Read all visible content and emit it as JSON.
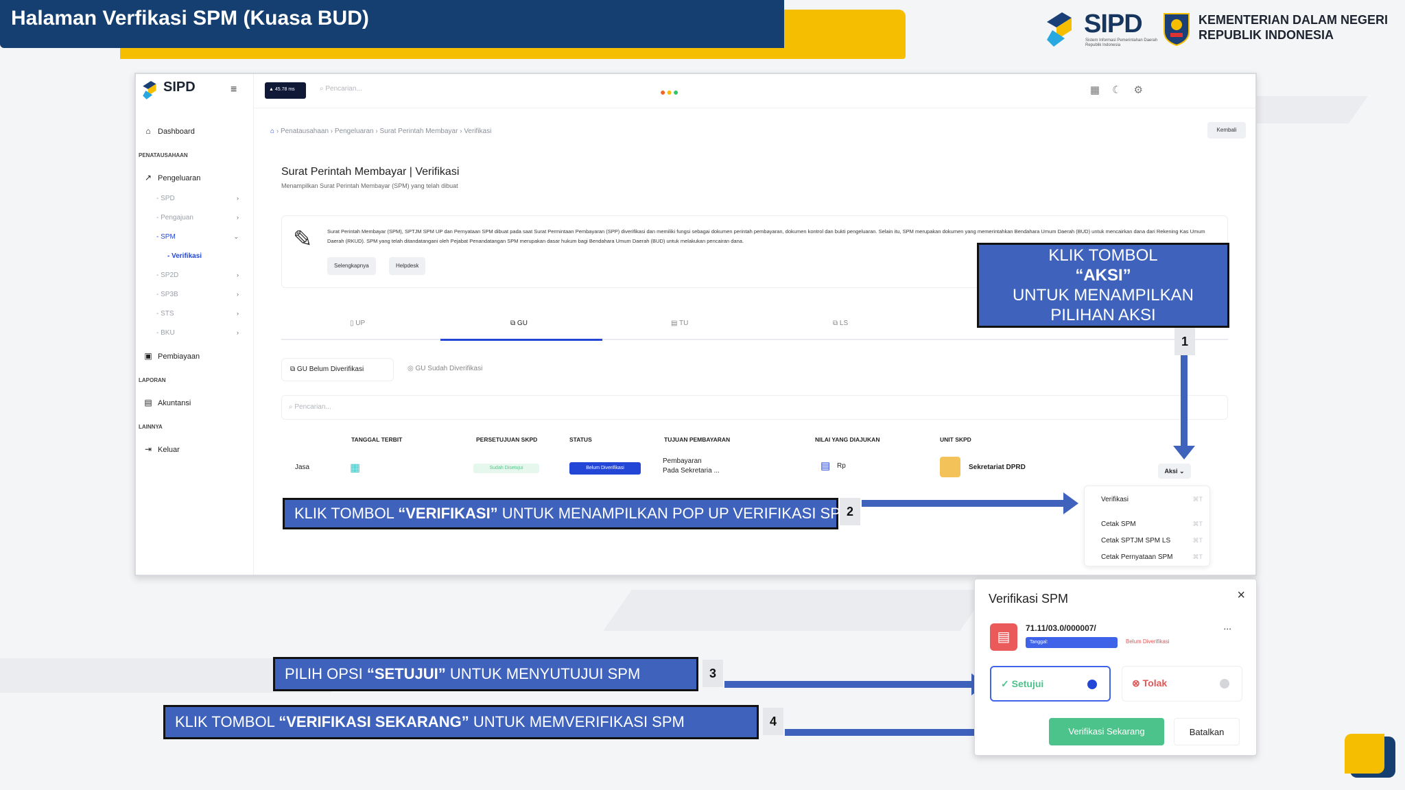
{
  "banner": {
    "title": "Halaman Verfikasi SPM (Kuasa BUD)"
  },
  "brand": {
    "sipd_word": "SIPD",
    "sipd_sub": "Sistem Informasi Pemerintahan Daerah Republik Indonesia",
    "ministry_line1": "KEMENTERIAN DALAM NEGERI",
    "ministry_line2": "REPUBLIK INDONESIA"
  },
  "app": {
    "logo": "SIPD",
    "topbar": {
      "chip": "▲ 45.78 ms",
      "search_placeholder": "Pencarian...",
      "back": "Kembali"
    },
    "sidebar": {
      "dashboard": "Dashboard",
      "section_penatausahaan": "PENATAUSAHAAN",
      "pengeluaran": "Pengeluaran",
      "sub": [
        "SPD",
        "Pengajuan",
        "SPM",
        "Verifikasi",
        "SP2D",
        "SP3B",
        "STS",
        "BKU"
      ],
      "pembiayaan": "Pembiayaan",
      "section_laporan": "LAPORAN",
      "akuntansi": "Akuntansi",
      "section_lainnya": "LAINNYA",
      "keluar": "Keluar"
    },
    "breadcrumb": "Penatausahaan  ›  Pengeluaran  ›  Surat Perintah Membayar  ›  Verifikasi",
    "card_title": "Surat Perintah Membayar | Verifikasi",
    "card_sub": "Menampilkan Surat Perintah Membayar (SPM) yang telah dibuat",
    "info_text": "Surat Perintah Membayar (SPM), SPTJM SPM UP dan Pernyataan SPM dibuat pada saat Surat Permintaan Pembayaran (SPP) diverifikasi dan memiliki fungsi sebagai dokumen perintah pembayaran, dokumen kontrol dan bukti pengeluaran. Selain itu, SPM merupakan dokumen yang memerintahkan Bendahara Umum Daerah (BUD) untuk mencairkan dana dari Rekening Kas Umum Daerah (RKUD). SPM yang telah ditandatangani oleh Pejabat Penandatangan SPM merupakan dasar hukum bagi Bendahara Umum Daerah (BUD) untuk melakukan pencairan dana.",
    "btn_selengkapnya": "Selengkapnya",
    "btn_helpdesk": "Helpdesk",
    "tabs": [
      "UP",
      "GU",
      "TU",
      "LS"
    ],
    "subtab_active": "GU Belum Diverifikasi",
    "subtab_other": "GU Sudah Diverifikasi",
    "table_search": "Pencarian...",
    "columns": [
      "TANGGAL TERBIT",
      "PERSETUJUAN SKPD",
      "STATUS",
      "TUJUAN PEMBAYARAN",
      "NILAI YANG DIAJUKAN",
      "UNIT SKPD"
    ],
    "row": {
      "jenis": "Jasa",
      "persetujuan": "Sudah Disetujui",
      "status": "Belum Diverifikasi",
      "tujuan_1": "Pembayaran",
      "tujuan_2": "Pada Sekretaria ...",
      "nilai": "Rp",
      "unit": "Sekretariat DPRD",
      "aksi": "Aksi ⌄"
    },
    "dropdown": [
      {
        "label": "Verifikasi",
        "kbd": "⌘T"
      },
      {
        "label": "Cetak SPM",
        "kbd": "⌘T"
      },
      {
        "label": "Cetak SPTJM SPM LS",
        "kbd": "⌘T"
      },
      {
        "label": "Cetak Pernyataan SPM",
        "kbd": "⌘T"
      }
    ]
  },
  "callouts": {
    "one_l1": "KLIK TOMBOL",
    "one_l2": "“AKSI”",
    "one_l3": "UNTUK MENAMPILKAN",
    "one_l4": "PILIHAN AKSI",
    "one_num": "1",
    "two_pre": "KLIK TOMBOL ",
    "two_bold": "“VERIFIKASI”",
    "two_post": " UNTUK MENAMPILKAN POP UP VERIFIKASI SPM",
    "two_num": "2",
    "three_pre": "PILIH OPSI ",
    "three_bold": "“SETUJUI”",
    "three_post": " UNTUK MENYUTUJUI SPM",
    "three_num": "3",
    "four_pre": "KLIK TOMBOL ",
    "four_bold": "“VERIFIKASI SEKARANG”",
    "four_post": " UNTUK MEMVERIFIKASI SPM",
    "four_num": "4"
  },
  "modal": {
    "title": "Verifikasi SPM",
    "close": "×",
    "number": "71.11/03.0/000007/",
    "more": "...",
    "tag": "Tanggal:",
    "status_red": "Belum Diverifikasi",
    "setuju": "Setujui",
    "tolak": "Tolak",
    "btn_verifikasi": "Verifikasi Sekarang",
    "btn_batal": "Batalkan"
  },
  "colors": {
    "navy": "#153f70",
    "yellow": "#f6be00",
    "callout_blue": "#3f63bc",
    "accent_blue": "#2346d6",
    "green": "#4cc38a"
  }
}
